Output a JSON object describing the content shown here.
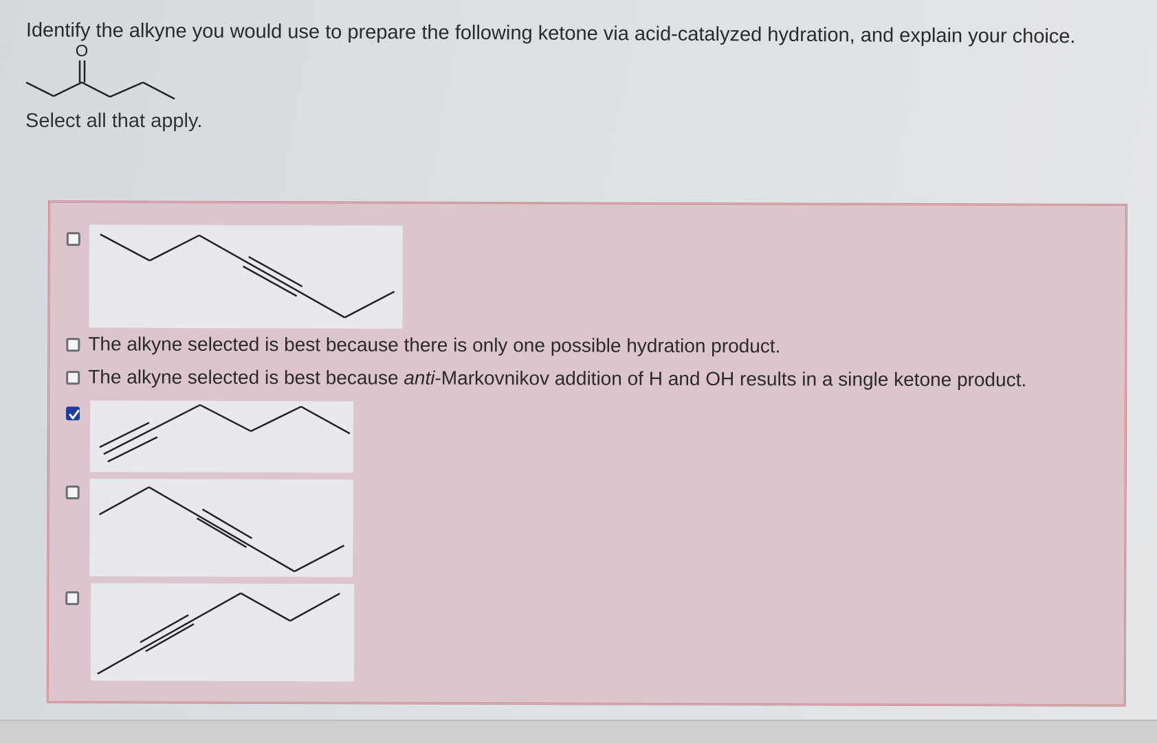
{
  "question": {
    "text": "Identify the alkyne you would use to prepare the following ketone via acid-catalyzed hydration, and explain your choice.",
    "oxygen_label": "O",
    "instruction": "Select all that apply."
  },
  "options": [
    {
      "kind": "structure",
      "checked": false,
      "name": "alkyne-option-1"
    },
    {
      "kind": "text",
      "checked": false,
      "text": "The alkyne selected is best because there is only one possible hydration product."
    },
    {
      "kind": "text",
      "checked": false,
      "text_before": "The alkyne selected is best because ",
      "text_italic": "anti",
      "text_after": "-Markovnikov addition of H and OH results in a single ketone product."
    },
    {
      "kind": "structure",
      "checked": true,
      "name": "alkyne-option-4"
    },
    {
      "kind": "structure",
      "checked": false,
      "name": "alkyne-option-5"
    },
    {
      "kind": "structure",
      "checked": false,
      "name": "alkyne-option-6"
    }
  ],
  "colors": {
    "panel_background": "#dcc6cc",
    "panel_border": "#c98088",
    "checkbox_checked": "#1f3f9e",
    "structure_card": "#e8e9ec"
  }
}
